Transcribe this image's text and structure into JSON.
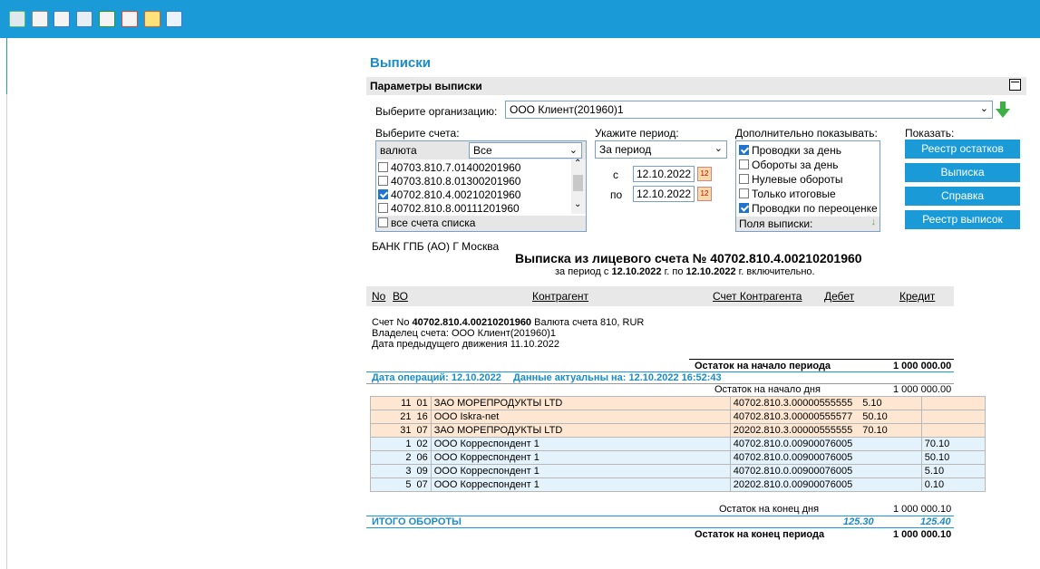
{
  "toolbar": {
    "icons": [
      "print-icon",
      "document-icon",
      "preview-icon",
      "print-settings-icon",
      "export-icon",
      "report-icon",
      "edit-icon",
      "chart-icon"
    ]
  },
  "page": {
    "title": "Выписки"
  },
  "params": {
    "header": "Параметры выписки",
    "org_label": "Выберите организацию:",
    "org_value": "ООО Клиент(201960)1",
    "accounts_label": "Выберите счета:",
    "currency_label": "валюта",
    "currency_value": "Все",
    "accounts": [
      {
        "number": "40703.810.7.01400201960",
        "checked": false
      },
      {
        "number": "40703.810.8.01300201960",
        "checked": false
      },
      {
        "number": "40702.810.4.00210201960",
        "checked": true
      },
      {
        "number": "40702.810.8.00111201960",
        "checked": false
      }
    ],
    "all_accounts_label": "все счета списка",
    "period_label": "Укажите период:",
    "period_value": "За период",
    "from_label": "с",
    "from_date": "12.10.2022",
    "to_label": "по",
    "to_date": "12.10.2022",
    "extra_label": "Дополнительно показывать:",
    "extra_options": [
      {
        "label": "Проводки за день",
        "checked": true
      },
      {
        "label": "Обороты за день",
        "checked": false
      },
      {
        "label": "Нулевые обороты",
        "checked": false
      },
      {
        "label": "Только итоговые",
        "checked": false
      },
      {
        "label": "Проводки по переоценке",
        "checked": true
      }
    ],
    "fields_label": "Поля выписки:",
    "show_label": "Показать:",
    "buttons": [
      "Реестр остатков",
      "Выписка",
      "Справка",
      "Реестр выписок"
    ]
  },
  "statement": {
    "bank": "БАНК ГПБ (АО) Г Москва",
    "title": "Выписка из лицевого счета № 40702.810.4.00210201960",
    "sub_prefix": "за период с",
    "from": "12.10.2022",
    "sub_mid": "г. по",
    "to": "12.10.2022",
    "sub_suffix": "г. включительно.",
    "columns": [
      "No",
      "ВО",
      "Контрагент",
      "Счет Контрагента",
      "Дебет",
      "Кредит"
    ],
    "account_line_prefix": "Счет No",
    "account_number": "40702.810.4.00210201960",
    "currency_text": "Валюта счета 810, RUR",
    "owner": "Владелец счета: ООО Клиент(201960)1",
    "prev_move": "Дата предыдущего движения 11.10.2022",
    "open_balance_label": "Остаток на начало периода",
    "open_balance": "1 000 000.00",
    "ops_date": "Дата операций: 12.10.2022",
    "actual": "Данные актуальны на: 12.10.2022 16:52:43",
    "day_open_label": "Остаток на начало дня",
    "day_open": "1 000 000.00",
    "rows": [
      {
        "no": "11",
        "vo": "01",
        "party": "ЗАО МОРЕПРОДУКТЫ LTD",
        "account": "40702.810.3.00000555555",
        "debit": "5.10",
        "credit": "",
        "kind": "own"
      },
      {
        "no": "21",
        "vo": "16",
        "party": "ООО Iskra-net",
        "account": "40702.810.3.00000555577",
        "debit": "50.10",
        "credit": "",
        "kind": "own"
      },
      {
        "no": "31",
        "vo": "07",
        "party": "ЗАО МОРЕПРОДУКТЫ LTD",
        "account": "20202.810.3.00000555555",
        "debit": "70.10",
        "credit": "",
        "kind": "own"
      },
      {
        "no": "1",
        "vo": "02",
        "party": "ООО Корреспондент 1",
        "account": "40702.810.0.00900076005",
        "debit": "",
        "credit": "70.10",
        "kind": "other"
      },
      {
        "no": "2",
        "vo": "06",
        "party": "ООО Корреспондент 1",
        "account": "40702.810.0.00900076005",
        "debit": "",
        "credit": "50.10",
        "kind": "other"
      },
      {
        "no": "3",
        "vo": "09",
        "party": "ООО Корреспондент 1",
        "account": "40702.810.0.00900076005",
        "debit": "",
        "credit": "5.10",
        "kind": "other"
      },
      {
        "no": "5",
        "vo": "07",
        "party": "ООО Корреспондент 1",
        "account": "20202.810.0.00900076005",
        "debit": "",
        "credit": "0.10",
        "kind": "other"
      }
    ],
    "day_close_label": "Остаток на конец дня",
    "day_close": "1 000 000.10",
    "totals_label": "ИТОГО ОБОРОТЫ",
    "total_debit": "125.30",
    "total_credit": "125.40",
    "close_balance_label": "Остаток на конец периода",
    "close_balance": "1 000 000.10"
  },
  "colors": {
    "accent": "#1a9bd7",
    "own_row": "#fde6d2",
    "other_row": "#e4f2fb"
  }
}
